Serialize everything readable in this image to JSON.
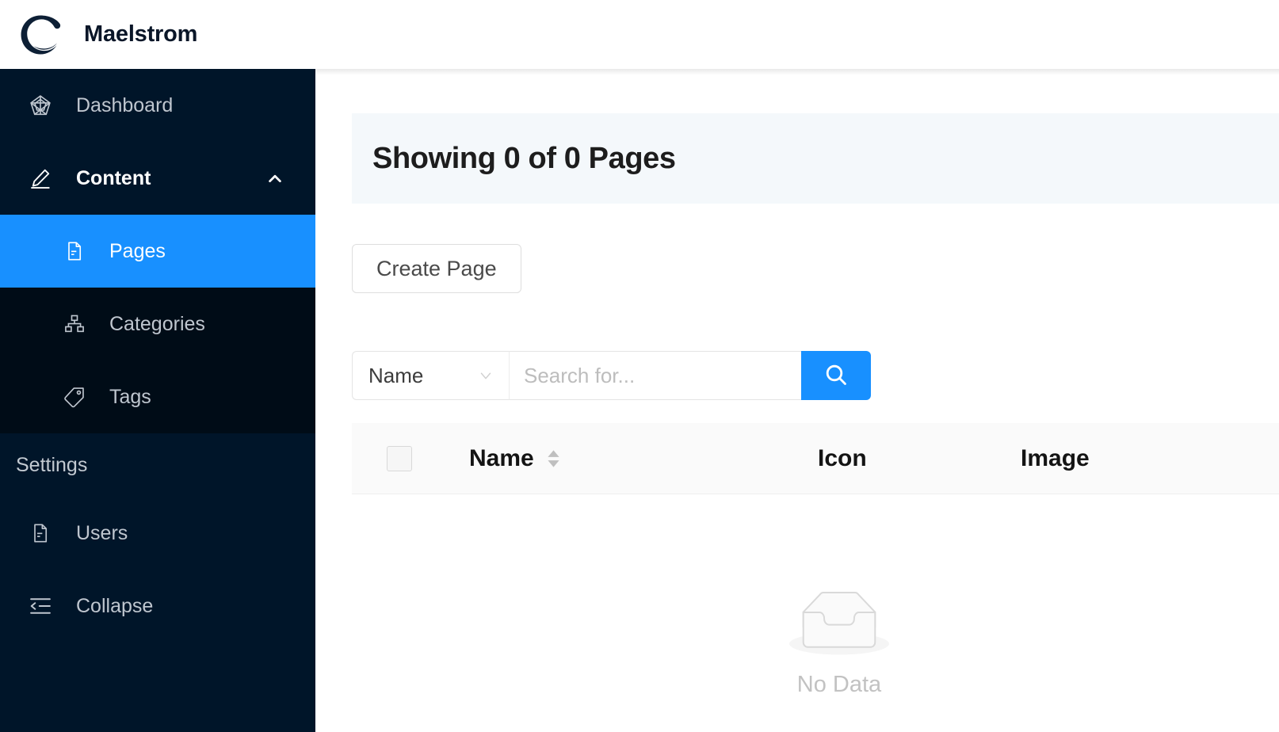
{
  "header": {
    "logo_icon": "maelstrom-swirl-logo",
    "title": "Maelstrom"
  },
  "sidebar": {
    "items": [
      {
        "label": "Dashboard",
        "icon": "radar-chart-icon"
      },
      {
        "label": "Content",
        "icon": "edit-pencil-icon",
        "expand_icon": "chevron-up-icon",
        "expanded": true
      }
    ],
    "submenu": [
      {
        "label": "Pages",
        "icon": "file-text-icon",
        "selected": true
      },
      {
        "label": "Categories",
        "icon": "sitemap-icon",
        "selected": false
      },
      {
        "label": "Tags",
        "icon": "tag-icon",
        "selected": false
      }
    ],
    "settings_group_label": "Settings",
    "settings_items": [
      {
        "label": "Users",
        "icon": "file-text-icon"
      },
      {
        "label": "Collapse",
        "icon": "menu-fold-icon"
      }
    ]
  },
  "main": {
    "banner_title": "Showing 0 of 0 Pages",
    "create_button_label": "Create Page",
    "search": {
      "field_selected": "Name",
      "field_caret_icon": "chevron-down-icon",
      "placeholder": "Search for...",
      "value": "",
      "button_icon": "search-icon"
    },
    "table": {
      "columns": [
        {
          "key": "select",
          "label": ""
        },
        {
          "key": "name",
          "label": "Name",
          "sortable": true,
          "sort_icon": "sort-arrows-icon"
        },
        {
          "key": "icon",
          "label": "Icon",
          "sortable": false
        },
        {
          "key": "image",
          "label": "Image",
          "sortable": false
        }
      ],
      "rows": [],
      "empty_icon": "empty-box-icon",
      "empty_label": "No Data"
    }
  },
  "colors": {
    "sidebar_bg": "#001529",
    "submenu_bg": "#000c17",
    "accent_blue": "#1890ff",
    "banner_bg": "#f4f8fb",
    "table_head_bg": "#fafafa",
    "brand_navy": "#0a1628"
  }
}
